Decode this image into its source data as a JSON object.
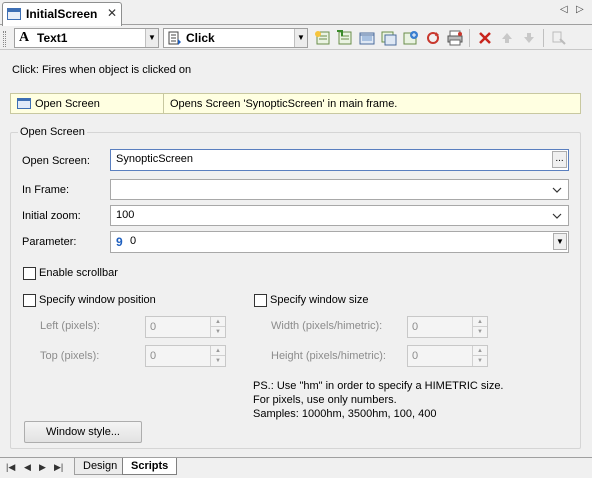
{
  "tab": {
    "title": "InitialScreen",
    "close": "✕"
  },
  "toolbar": {
    "object_combo": {
      "icon": "A",
      "value": "Text1"
    },
    "event_combo": {
      "value": "Click"
    },
    "buttons": [
      "new-action-icon",
      "insert-action-icon",
      "edit-action-icon",
      "copy-action-icon",
      "import-action-icon",
      "refresh-icon",
      "print-icon",
      "delete-icon",
      "move-up-icon",
      "move-down-icon",
      "tools-icon"
    ]
  },
  "description": "Click: Fires when object is clicked on",
  "action_list": [
    {
      "name": "Open Screen",
      "description": "Opens Screen 'SynopticScreen' in main frame."
    }
  ],
  "group": {
    "legend": "Open Screen",
    "open_screen": {
      "label": "Open Screen:",
      "value": "SynopticScreen",
      "button": "..."
    },
    "in_frame": {
      "label": "In Frame:",
      "value": ""
    },
    "initial_zoom": {
      "label": "Initial zoom:",
      "value": "100"
    },
    "parameter": {
      "label": "Parameter:",
      "icon": "9",
      "value": "0"
    },
    "enable_scrollbar": {
      "label": "Enable scrollbar",
      "checked": false
    },
    "specify_window_position": {
      "label": "Specify window position",
      "checked": false
    },
    "left": {
      "label": "Left (pixels):",
      "value": "0"
    },
    "top": {
      "label": "Top (pixels):",
      "value": "0"
    },
    "specify_window_size": {
      "label": "Specify window size",
      "checked": false
    },
    "width": {
      "label": "Width (pixels/himetric):",
      "value": "0"
    },
    "height": {
      "label": "Height (pixels/himetric):",
      "value": "0"
    },
    "note_lines": [
      "PS.: Use \"hm\" in order to specify a HIMETRIC size.",
      "For pixels, use only numbers.",
      "Samples: 1000hm, 3500hm, 100, 400"
    ],
    "window_style_button": "Window style..."
  },
  "bottom_tabs": [
    {
      "label": "Design",
      "active": false
    },
    {
      "label": "Scripts",
      "active": true
    }
  ],
  "colors": {
    "action_bg": "#ffffe1",
    "accent": "#1e5fbf"
  }
}
